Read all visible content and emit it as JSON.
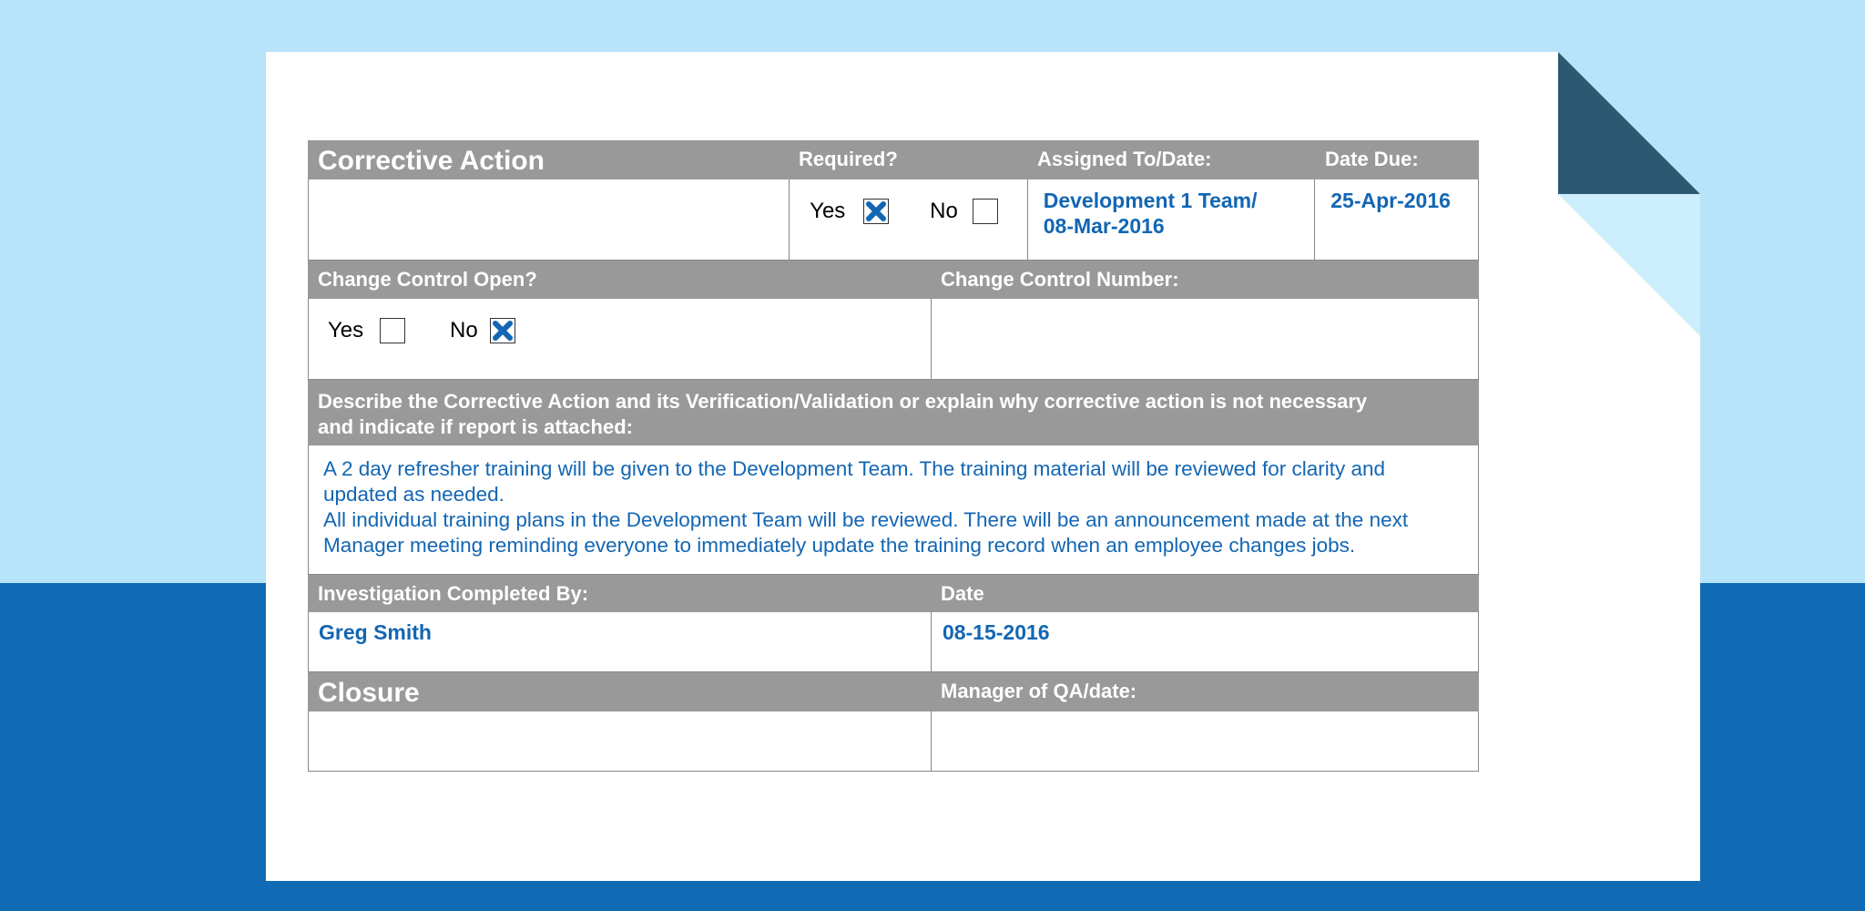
{
  "corrective_action": {
    "title": "Corrective Action",
    "required_label": "Required?",
    "assigned_label": "Assigned To/Date:",
    "date_due_label": "Date Due:",
    "required_yes_label": "Yes",
    "required_no_label": "No",
    "required_yes_checked": true,
    "required_no_checked": false,
    "assigned_line1": "Development 1 Team/",
    "assigned_line2": "08-Mar-2016",
    "date_due": "25-Apr-2016"
  },
  "change_control": {
    "open_label": "Change Control Open?",
    "number_label": "Change Control Number:",
    "yes_label": "Yes",
    "no_label": "No",
    "yes_checked": false,
    "no_checked": true,
    "number_value": ""
  },
  "description": {
    "label_line1": "Describe the Corrective Action and its Verification/Validation or explain why corrective action is not necessary",
    "label_line2": "and indicate if report is attached:",
    "lines": [
      "A 2 day refresher training will be given to the Development Team.  The training material will be reviewed for clarity and",
      "updated as needed.",
      "All individual training plans in the Development Team will be reviewed.  There will be an announcement made at the next",
      "Manager meeting reminding everyone to immediately update the training record when an employee changes jobs."
    ]
  },
  "investigation": {
    "completed_by_label": "Investigation Completed By:",
    "date_label": "Date",
    "completed_by": "Greg Smith",
    "date": "08-15-2016"
  },
  "closure": {
    "title": "Closure",
    "manager_label": "Manager of QA/date:",
    "closure_value": "",
    "manager_value": ""
  },
  "colors": {
    "header_gray": "#999999",
    "value_blue": "#1366b3",
    "bg_light": "#b7e4f8",
    "bg_dark": "#116bb4",
    "fold": "#2d5871"
  }
}
